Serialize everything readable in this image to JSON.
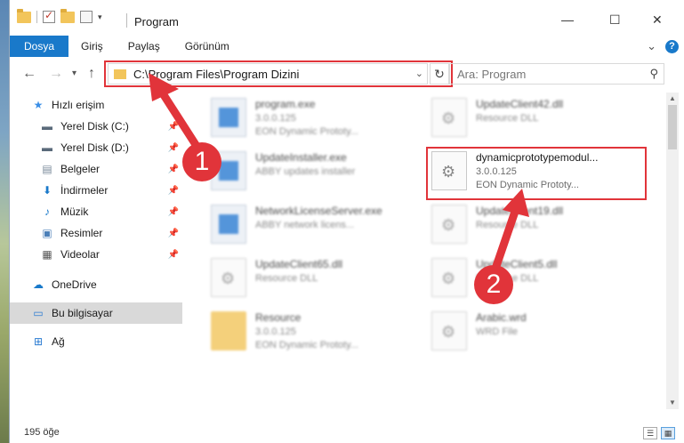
{
  "window": {
    "title": "Program",
    "minimize": "—",
    "maximize": "☐",
    "close": "✕"
  },
  "ribbon": {
    "tabs": [
      "Dosya",
      "Giriş",
      "Paylaş",
      "Görünüm"
    ],
    "expand": "⌄",
    "help": "?"
  },
  "nav": {
    "back": "←",
    "forward": "→",
    "recent": "▾",
    "up": "↑",
    "address": "C:\\Program Files\\Program Dizini",
    "address_dropdown": "⌄",
    "refresh": "↻",
    "search_placeholder": "Ara: Program",
    "search_icon": "⚲"
  },
  "sidebar": {
    "items": [
      {
        "label": "Hızlı erişim",
        "icon": "star-icon",
        "glyph": "★",
        "color": "#3a8ee6",
        "pinned": false
      },
      {
        "label": "Yerel Disk (C:)",
        "icon": "drive-icon",
        "glyph": "▬",
        "color": "#5a6a7a",
        "pinned": true
      },
      {
        "label": "Yerel Disk (D:)",
        "icon": "drive-icon",
        "glyph": "▬",
        "color": "#5a6a7a",
        "pinned": true
      },
      {
        "label": "Belgeler",
        "icon": "documents-icon",
        "glyph": "▤",
        "color": "#7a8a9a",
        "pinned": true
      },
      {
        "label": "İndirmeler",
        "icon": "download-icon",
        "glyph": "⬇",
        "color": "#1979ca",
        "pinned": true
      },
      {
        "label": "Müzik",
        "icon": "music-icon",
        "glyph": "♪",
        "color": "#1979ca",
        "pinned": true
      },
      {
        "label": "Resimler",
        "icon": "pictures-icon",
        "glyph": "▣",
        "color": "#4b7fb8",
        "pinned": true
      },
      {
        "label": "Videolar",
        "icon": "videos-icon",
        "glyph": "▦",
        "color": "#555",
        "pinned": true
      },
      {
        "label": "OneDrive",
        "icon": "cloud-icon",
        "glyph": "☁",
        "color": "#1979ca",
        "pinned": false
      },
      {
        "label": "Bu bilgisayar",
        "icon": "computer-icon",
        "glyph": "▭",
        "color": "#2a7bd2",
        "pinned": false
      },
      {
        "label": "Ağ",
        "icon": "network-icon",
        "glyph": "⊞",
        "color": "#2a7bd2",
        "pinned": false
      }
    ],
    "pin_glyph": "📌"
  },
  "files": [
    {
      "name": "program.exe",
      "meta1": "3.0.0.125",
      "meta2": "EON Dynamic Prototy...",
      "icon": "exe-icon"
    },
    {
      "name": "UpdateClient42.dll",
      "meta1": "Resource DLL",
      "meta2": "",
      "icon": "dll-icon"
    },
    {
      "name": "UpdateInstaller.exe",
      "meta1": "ABBY updates installer",
      "meta2": "",
      "icon": "exe-icon"
    },
    {
      "name": "dynamicprototypemodul...",
      "meta1": "3.0.0.125",
      "meta2": "EON Dynamic Prototy...",
      "icon": "dll-icon"
    },
    {
      "name": "NetworkLicenseServer.exe",
      "meta1": "ABBY network licens...",
      "meta2": "",
      "icon": "exe-icon"
    },
    {
      "name": "UpdateClient19.dll",
      "meta1": "Resource DLL",
      "meta2": "",
      "icon": "dll-icon"
    },
    {
      "name": "UpdateClient65.dll",
      "meta1": "Resource DLL",
      "meta2": "",
      "icon": "dll-icon"
    },
    {
      "name": "UpdateClient5.dll",
      "meta1": "Resource DLL",
      "meta2": "",
      "icon": "dll-icon"
    },
    {
      "name": "Resource",
      "meta1": "3.0.0.125",
      "meta2": "EON Dynamic Prototy...",
      "icon": "folder-icon"
    },
    {
      "name": "Arabic.wrd",
      "meta1": "WRD File",
      "meta2": "",
      "icon": "file-icon"
    }
  ],
  "status": {
    "item_count": "195 öğe"
  },
  "annotations": {
    "step1": "1",
    "step2": "2",
    "color": "#e1343a"
  }
}
